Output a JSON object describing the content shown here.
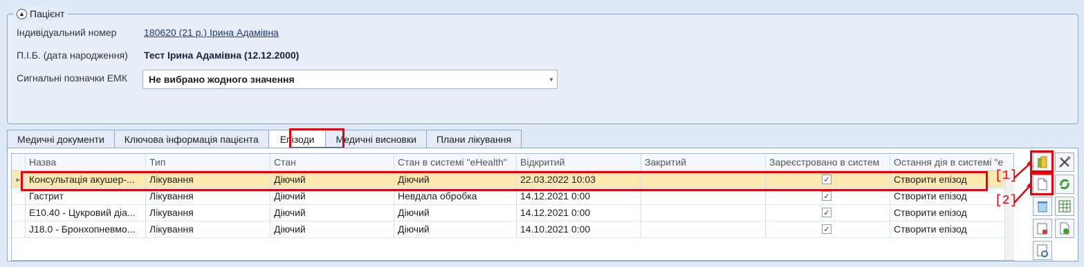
{
  "patient": {
    "legend": "Пацієнт",
    "id_label": "Індивідуальний номер",
    "id_value": "180620 (21 р.) Ірина Адамівна",
    "name_label": "П.І.Б. (дата народження)",
    "name_value": "Тест Ірина Адамівна (12.12.2000)",
    "signals_label": "Сигнальні позначки ЕМК",
    "signals_value": "Не вибрано жодного значення"
  },
  "tabs": [
    {
      "label": "Медичні документи",
      "active": false
    },
    {
      "label": "Ключова інформація пацієнта",
      "active": false
    },
    {
      "label": "Епізоди",
      "active": true
    },
    {
      "label": "Медичні висновки",
      "active": false
    },
    {
      "label": "Плани лікування",
      "active": false
    }
  ],
  "grid": {
    "columns": [
      "Назва",
      "Тип",
      "Стан",
      "Стан в системі \"eHealth\"",
      "Відкритий",
      "Закритий",
      "Зареєстровано в систем",
      "Остання дія в системі \"е"
    ],
    "rows": [
      {
        "name": "Консультація акушер-...",
        "type": "Лікування",
        "state": "Діючий",
        "ehealth_state": "Діючий",
        "opened": "22.03.2022 10:03",
        "closed": "",
        "registered": true,
        "last_action": "Створити епізод"
      },
      {
        "name": "Гастрит",
        "type": "Лікування",
        "state": "Діючий",
        "ehealth_state": "Невдала обробка",
        "opened": "14.12.2021 0:00",
        "closed": "",
        "registered": true,
        "last_action": "Створити епізод"
      },
      {
        "name": "E10.40 - Цукровий діа...",
        "type": "Лікування",
        "state": "Діючий",
        "ehealth_state": "Діючий",
        "opened": "14.12.2021 0:00",
        "closed": "",
        "registered": true,
        "last_action": "Створити епізод"
      },
      {
        "name": "J18.0 - Бронхопневмо...",
        "type": "Лікування",
        "state": "Діючий",
        "ehealth_state": "Діючий",
        "opened": "14.10.2021 0:00",
        "closed": "",
        "registered": true,
        "last_action": "Створити епізод"
      }
    ]
  },
  "markers": {
    "m1": "[1]",
    "m2": "[2]"
  },
  "colors": {
    "highlight": "#e8000b",
    "selected_row": "#fde9b0",
    "background": "#dfe8f6"
  }
}
